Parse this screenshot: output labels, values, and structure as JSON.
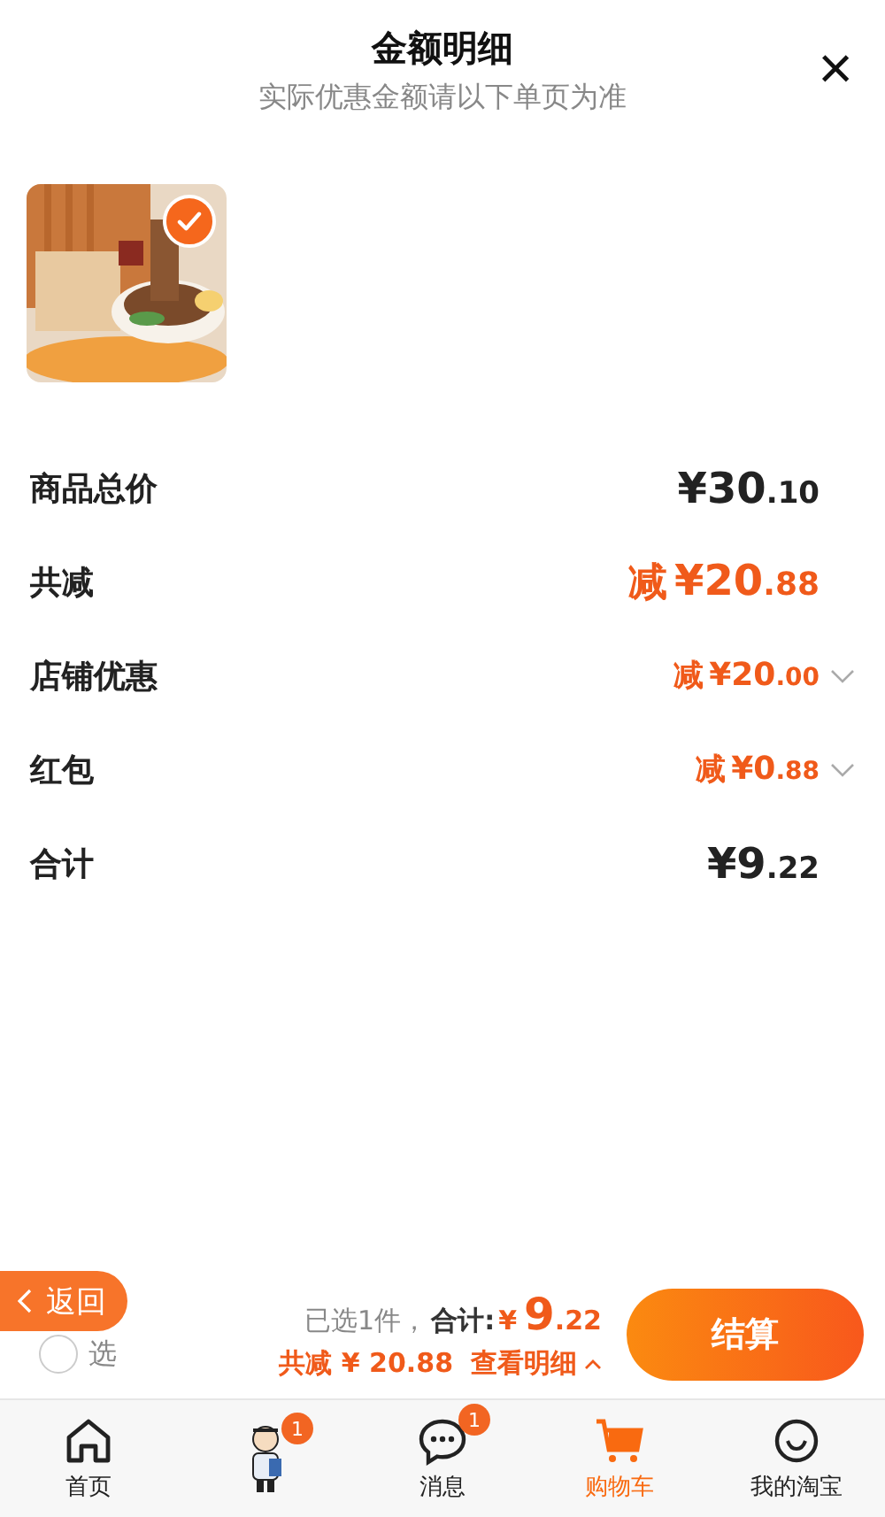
{
  "header": {
    "title": "金额明细",
    "subtitle": "实际优惠金额请以下单页为准",
    "close": "×"
  },
  "product": {
    "checked": true
  },
  "rows": [
    {
      "kind": "total",
      "label": "商品总价",
      "prefix": "",
      "integer": "¥30",
      "decimal": ".10",
      "expandable": false
    },
    {
      "kind": "reduction",
      "label": "共减",
      "prefix": "减",
      "integer": "¥20",
      "decimal": ".88",
      "expandable": false
    },
    {
      "kind": "sub_reduction",
      "label": "店铺优惠",
      "prefix": "减",
      "integer": "¥20",
      "decimal": ".00",
      "expandable": true
    },
    {
      "kind": "sub_reduction",
      "label": "红包",
      "prefix": "减",
      "integer": "¥0",
      "decimal": ".88",
      "expandable": true
    },
    {
      "kind": "total",
      "label": "合计",
      "prefix": "",
      "integer": "¥9",
      "decimal": ".22",
      "expandable": false
    }
  ],
  "checkout_bar": {
    "select_all": {
      "label": "选",
      "checked": false
    },
    "back_button": "返回",
    "selected_count": "已选1件，",
    "total_label": "合计:",
    "total_symbol": "¥",
    "total_integer": "9",
    "total_decimal": ".22",
    "reduction": "共减 ¥ 20.88",
    "details_link": "查看明细",
    "checkout_button": "结算"
  },
  "tab_bar": [
    {
      "label": "首页",
      "selected": false
    },
    {
      "badge": "1",
      "selected": false
    },
    {
      "label": "消息",
      "badge": "1",
      "selected": false
    },
    {
      "label": "购物车",
      "selected": true
    },
    {
      "label": "我的淘宝",
      "selected": false
    }
  ]
}
